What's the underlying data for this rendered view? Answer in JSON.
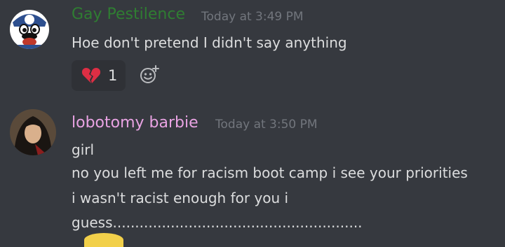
{
  "messages": [
    {
      "username": "Gay Pestilence",
      "timestamp": "Today at 3:49 PM",
      "lines": [
        "Hoe don't pretend I didn't say anything"
      ],
      "reaction": {
        "emoji": "broken-heart-icon",
        "count": "1"
      }
    },
    {
      "username": "lobotomy barbie",
      "timestamp": "Today at 3:50 PM",
      "lines": [
        "girl",
        "no you left me for racism boot camp i see your priorities",
        "i wasn't racist enough for you i",
        "guess........................................................"
      ]
    }
  ],
  "colors": {
    "background": "#36393f",
    "username_1": "#2f7d32",
    "username_2": "#e9a3e3",
    "text": "#dcddde",
    "timestamp": "#72767d",
    "reaction_bg": "#2f3136",
    "reaction_emoji": "#dd2e44"
  }
}
